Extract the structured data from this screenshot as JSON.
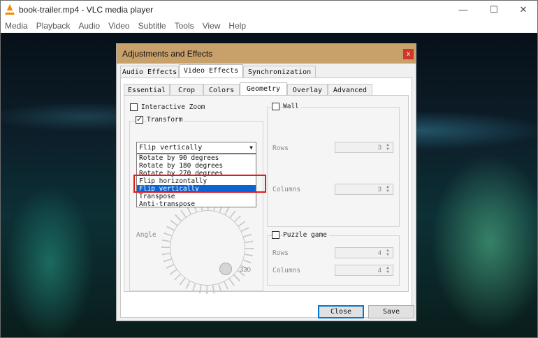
{
  "window": {
    "title": "book-trailer.mp4 - VLC media player",
    "minimize": "—",
    "maximize": "☐",
    "close": "✕"
  },
  "menu": [
    "Media",
    "Playback",
    "Audio",
    "Video",
    "Subtitle",
    "Tools",
    "View",
    "Help"
  ],
  "dialog": {
    "title": "Adjustments and Effects",
    "close": "x",
    "main_tabs": [
      "Audio Effects",
      "Video Effects",
      "Synchronization"
    ],
    "main_tab_selected": "Video Effects",
    "sub_tabs": [
      "Essential",
      "Crop",
      "Colors",
      "Geometry",
      "Overlay",
      "Advanced"
    ],
    "sub_tab_selected": "Geometry",
    "interactive_zoom": {
      "label": "Interactive Zoom",
      "checked": false
    },
    "transform": {
      "label": "Transform",
      "checked": true,
      "selected": "Flip vertically",
      "options": [
        "Rotate by 90 degrees",
        "Rotate by 180 degrees",
        "Rotate by 270 degrees",
        "Flip horizontally",
        "Flip vertically",
        "Transpose",
        "Anti-transpose"
      ]
    },
    "angle": {
      "label": "Angle",
      "value": "330"
    },
    "wall": {
      "label": "Wall",
      "checked": false,
      "rows_label": "Rows",
      "rows": "3",
      "columns_label": "Columns",
      "columns": "3"
    },
    "puzzle": {
      "label": "Puzzle game",
      "checked": false,
      "rows_label": "Rows",
      "rows": "4",
      "columns_label": "Columns",
      "columns": "4"
    },
    "close_button": "Close",
    "save_button": "Save"
  }
}
